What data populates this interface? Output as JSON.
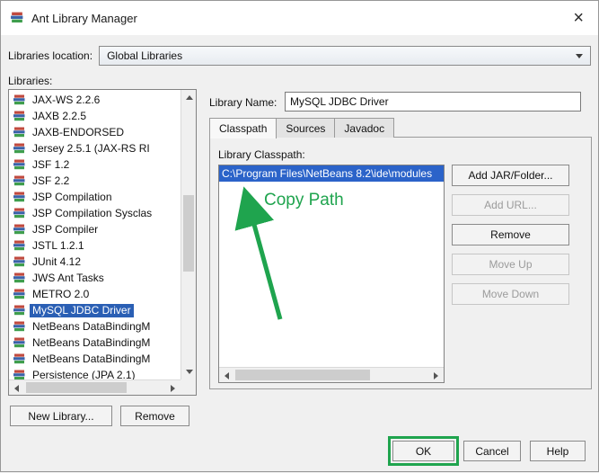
{
  "colors": {
    "selection_blue": "#2a5fb4",
    "classpath_selection_blue": "#2b63c9",
    "annotation_green": "#1fa44e"
  },
  "window": {
    "title": "Ant Library Manager",
    "close_symbol": "×"
  },
  "location": {
    "label": "Libraries location:",
    "value": "Global Libraries"
  },
  "libraries": {
    "label": "Libraries:",
    "items": [
      {
        "label": "JAX-WS 2.2.6",
        "selected": false
      },
      {
        "label": "JAXB 2.2.5",
        "selected": false
      },
      {
        "label": "JAXB-ENDORSED",
        "selected": false
      },
      {
        "label": "Jersey 2.5.1 (JAX-RS RI",
        "selected": false
      },
      {
        "label": "JSF 1.2",
        "selected": false
      },
      {
        "label": "JSF 2.2",
        "selected": false
      },
      {
        "label": "JSP Compilation",
        "selected": false
      },
      {
        "label": "JSP Compilation Sysclas",
        "selected": false
      },
      {
        "label": "JSP Compiler",
        "selected": false
      },
      {
        "label": "JSTL 1.2.1",
        "selected": false
      },
      {
        "label": "JUnit 4.12",
        "selected": false
      },
      {
        "label": "JWS Ant Tasks",
        "selected": false
      },
      {
        "label": "METRO 2.0",
        "selected": false
      },
      {
        "label": "MySQL JDBC Driver",
        "selected": true
      },
      {
        "label": "NetBeans DataBindingM",
        "selected": false
      },
      {
        "label": "NetBeans DataBindingM",
        "selected": false
      },
      {
        "label": "NetBeans DataBindingM",
        "selected": false
      },
      {
        "label": "Persistence (JPA 2.1)",
        "selected": false
      }
    ]
  },
  "detail": {
    "name_label": "Library Name:",
    "name_value": "MySQL JDBC Driver",
    "tabs": [
      {
        "label": "Classpath",
        "active": true
      },
      {
        "label": "Sources",
        "active": false
      },
      {
        "label": "Javadoc",
        "active": false
      }
    ],
    "classpath_label": "Library Classpath:",
    "classpath_items": [
      {
        "label": "C:\\Program Files\\NetBeans 8.2\\ide\\modules",
        "selected": true
      }
    ],
    "side_buttons": [
      {
        "label": "Add JAR/Folder...",
        "enabled": true
      },
      {
        "label": "Add URL...",
        "enabled": false
      },
      {
        "label": "Remove",
        "enabled": true
      },
      {
        "label": "Move Up",
        "enabled": false
      },
      {
        "label": "Move Down",
        "enabled": false
      }
    ]
  },
  "footer": {
    "new_library": "New Library...",
    "remove": "Remove",
    "ok": "OK",
    "cancel": "Cancel",
    "help": "Help"
  },
  "annotation": {
    "copy_path_label": "Copy Path"
  }
}
